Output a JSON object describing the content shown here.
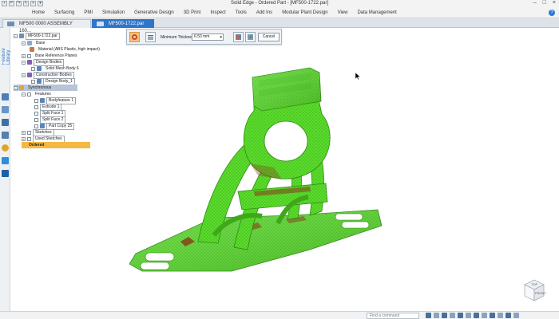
{
  "titlebar": {
    "title": "Solid Edge - Ordered Part - [MF500-1722.par]",
    "quick_access": [
      "save",
      "undo",
      "redo",
      "select",
      "new",
      "open"
    ],
    "window_controls": [
      "minimize",
      "maximize",
      "close"
    ]
  },
  "ribbon": {
    "tabs": [
      "Home",
      "Surfacing",
      "PMI",
      "Simulation",
      "Generative Design",
      "3D Print",
      "Inspect",
      "Tools",
      "Add Ins",
      "Modular Plant Design",
      "View",
      "Data Management"
    ],
    "help": "?"
  },
  "doc_tabs": [
    {
      "label": "MF500 0000 ASSEMBLY 160...",
      "close": "×"
    },
    {
      "label": "MF500-1722.par",
      "close": "×"
    }
  ],
  "left_strip": {
    "label": "Feature Library",
    "icons": [
      "pathfinder-icon",
      "layers-icon",
      "sensors-icon",
      "library-icon",
      "family-icon",
      "key-icon",
      "tree-icon",
      "file-icon"
    ]
  },
  "tree": {
    "part": "MF500-1722.par",
    "base": "Base",
    "material": "Material (ABS Plastic, high impact)",
    "base_ref": "Base Reference Planes",
    "design_bodies": "Design Bodies",
    "solid_mesh": "Solid Mesh Body 6",
    "construction_bodies": "Construction Bodies",
    "design_body": "Design Body_1",
    "synchronous": "Synchronous",
    "features": "Features",
    "body_feature": "Bodyfeature 1",
    "extrude": "Extrude 1",
    "split_face_1": "Split Face 1",
    "split_face_2": "Split Face 2",
    "part_copy": "Part Copy 25",
    "sketches": "Sketches",
    "used_sketches": "Used Sketches",
    "ordered": "Ordered"
  },
  "command_bar": {
    "label": "Minimum Thickness:",
    "value": "6.50 mm",
    "cancel": "Cancel"
  },
  "view_cube": {
    "top": "TOP",
    "front": "FRONT"
  },
  "statusbar": {
    "comment_placeholder": "Find a command"
  },
  "colors": {
    "accent": "#2f75c9",
    "mesh_green": "#5ce02e",
    "thin_region": "#8a3a1a",
    "ordered_bar": "#f5b942"
  }
}
